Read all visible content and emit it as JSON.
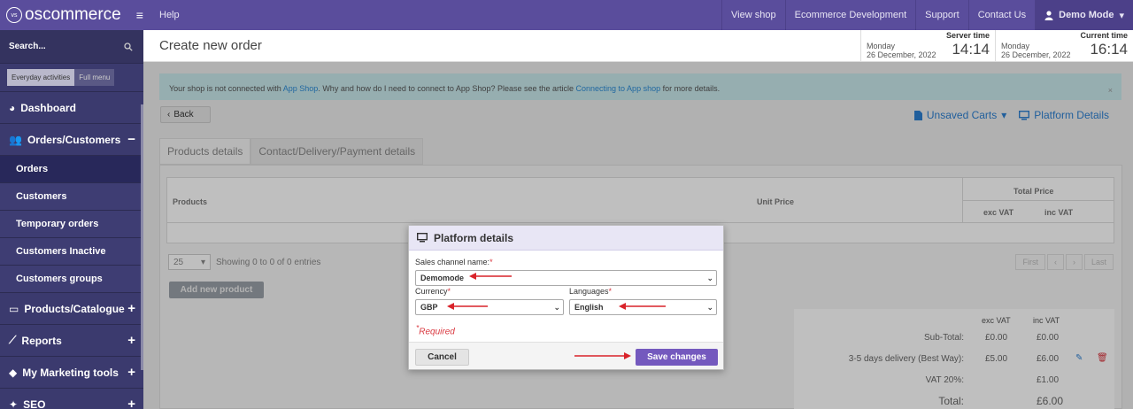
{
  "topbar": {
    "logo_text": "oscommerce",
    "logo_mark": "vs",
    "help": "Help",
    "links": [
      "View shop",
      "Ecommerce Development",
      "Support",
      "Contact Us"
    ],
    "user": "Demo Mode"
  },
  "sidebar": {
    "search_label": "Search...",
    "mode_everyday": "Everyday activities",
    "mode_full": "Full menu",
    "dashboard": "Dashboard",
    "orders_customers": "Orders/Customers",
    "sub_items": [
      "Orders",
      "Customers",
      "Temporary orders",
      "Customers Inactive",
      "Customers groups"
    ],
    "products_catalogue": "Products/Catalogue",
    "reports": "Reports",
    "marketing": "My Marketing tools",
    "seo": "SEO"
  },
  "header": {
    "title": "Create new order",
    "server_time_label": "Server time",
    "server_day": "Monday",
    "server_date": "26 December, 2022",
    "server_clock": "14:14",
    "current_time_label": "Current time",
    "current_day": "Monday",
    "current_date": "26 December, 2022",
    "current_clock": "16:14"
  },
  "notice": {
    "part1": "Your shop is not connected with ",
    "link1": "App Shop",
    "part2": ". Why and how do I need to connect to App Shop? Please see the article ",
    "link2": "Connecting to App shop",
    "part3": " for more details.",
    "close": "×"
  },
  "back_label": "Back",
  "unsaved_carts": "Unsaved Carts",
  "platform_details_link": "Platform Details",
  "tabs": [
    "Products details",
    "Contact/Delivery/Payment details"
  ],
  "table": {
    "products": "Products",
    "unit_price": "Unit Price",
    "total_price": "Total Price",
    "exc_vat": "exc VAT",
    "inc_vat": "inc VAT"
  },
  "list": {
    "page_size": "25",
    "showing": "Showing 0 to 0 of 0 entries",
    "pager": [
      "First",
      "‹",
      "›",
      "Last"
    ],
    "add_product": "Add new product"
  },
  "totals": {
    "exc_vat": "exc VAT",
    "inc_vat": "inc VAT",
    "rows": [
      {
        "label": "Sub-Total:",
        "exc": "£0.00",
        "inc": "£0.00"
      },
      {
        "label": "3-5 days delivery (Best Way):",
        "exc": "£5.00",
        "inc": "£6.00"
      },
      {
        "label": "VAT 20%:",
        "exc": "",
        "inc": "£1.00"
      },
      {
        "label": "Total:",
        "exc": "",
        "inc": "£6.00"
      }
    ]
  },
  "modal": {
    "title": "Platform details",
    "sales_channel_label": "Sales channel name:",
    "sales_channel_value": "Demomode",
    "currency_label": "Currency",
    "currency_value": "GBP",
    "languages_label": "Languages",
    "languages_value": "English",
    "required_star": "*",
    "required_note": "Required",
    "cancel": "Cancel",
    "save": "Save changes"
  },
  "colors": {
    "brand": "#5a4d9c",
    "sidebar": "#3b3a6e",
    "save_button": "#7459be",
    "link": "#2c7fd1",
    "annotation_arrow": "#d9232a"
  }
}
